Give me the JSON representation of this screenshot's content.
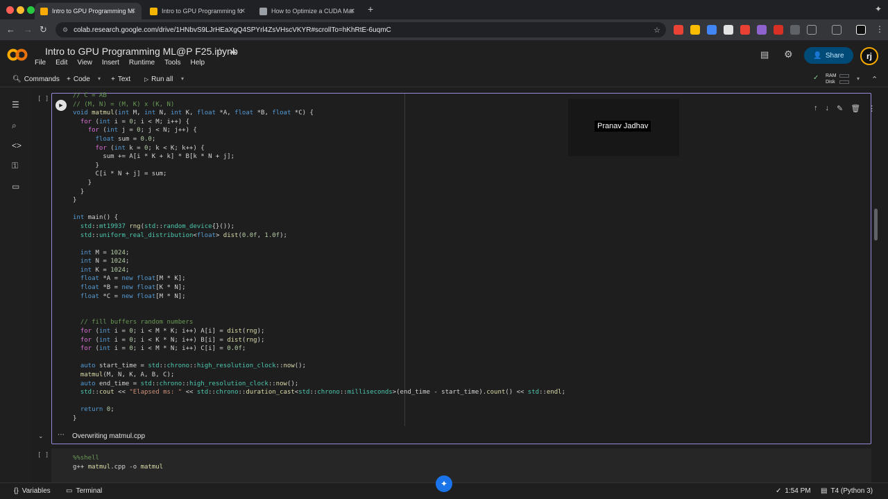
{
  "browser": {
    "tabs": [
      {
        "title": "Intro to GPU Programming ML",
        "active": true,
        "favicon_color": "#f9ab00"
      },
      {
        "title": "Intro to GPU Programming fo",
        "active": false,
        "favicon_color": "#f4b400"
      },
      {
        "title": "How to Optimize a CUDA Mat",
        "active": false,
        "favicon_color": "#9aa0a6"
      }
    ],
    "url": "colab.research.google.com/drive/1HNbvS9LJrHEaXgQ4SPYrl4ZsVHscVKYR#scrollTo=hKhRtE-6uqmC"
  },
  "colab": {
    "title": "Intro to GPU Programming ML@P F25.ipynb",
    "menu": [
      "File",
      "Edit",
      "View",
      "Insert",
      "Runtime",
      "Tools",
      "Help"
    ],
    "share_label": "Share",
    "toolbar": {
      "commands": "Commands",
      "code": "Code",
      "text": "Text",
      "run_all": "Run all",
      "ram": "RAM",
      "disk": "Disk"
    }
  },
  "cell": {
    "bracket": "[ ]",
    "overlay_name": "Pranav Jadhav",
    "output_text": "Overwriting matmul.cpp",
    "code_lines": [
      "// C = AB",
      "// (M, N) = (M, K) x (K, N)",
      "void matmul(int M, int N, int K, float *A, float *B, float *C) {",
      "  for (int i = 0; i < M; i++) {",
      "    for (int j = 0; j < N; j++) {",
      "      float sum = 0.0;",
      "      for (int k = 0; k < K; k++) {",
      "        sum += A[i * K + k] * B[k * N + j];",
      "      }",
      "      C[i * N + j] = sum;",
      "    }",
      "  }",
      "}",
      "",
      "int main() {",
      "  std::mt19937 rng(std::random_device{}());",
      "  std::uniform_real_distribution<float> dist(0.0f, 1.0f);",
      "",
      "  int M = 1024;",
      "  int N = 1024;",
      "  int K = 1024;",
      "  float *A = new float[M * K];",
      "  float *B = new float[K * N];",
      "  float *C = new float[M * N];",
      "",
      "",
      "  // fill buffers random numbers",
      "  for (int i = 0; i < M * K; i++) A[i] = dist(rng);",
      "  for (int i = 0; i < K * N; i++) B[i] = dist(rng);",
      "  for (int i = 0; i < M * N; i++) C[i] = 0.0f;",
      "",
      "  auto start_time = std::chrono::high_resolution_clock::now();",
      "  matmul(M, N, K, A, B, C);",
      "  auto end_time = std::chrono::high_resolution_clock::now();",
      "  std::cout << \"Elapsed ms: \" << std::chrono::duration_cast<std::chrono::milliseconds>(end_time - start_time).count() << std::endl;",
      "",
      "  return 0;",
      "}"
    ]
  },
  "cell2": {
    "bracket": "[ ]",
    "code_lines": [
      "%%shell",
      "g++ matmul.cpp -o matmul"
    ]
  },
  "statusbar": {
    "variables": "Variables",
    "terminal": "Terminal",
    "time": "1:54 PM",
    "runtime": "T4 (Python 3)"
  }
}
